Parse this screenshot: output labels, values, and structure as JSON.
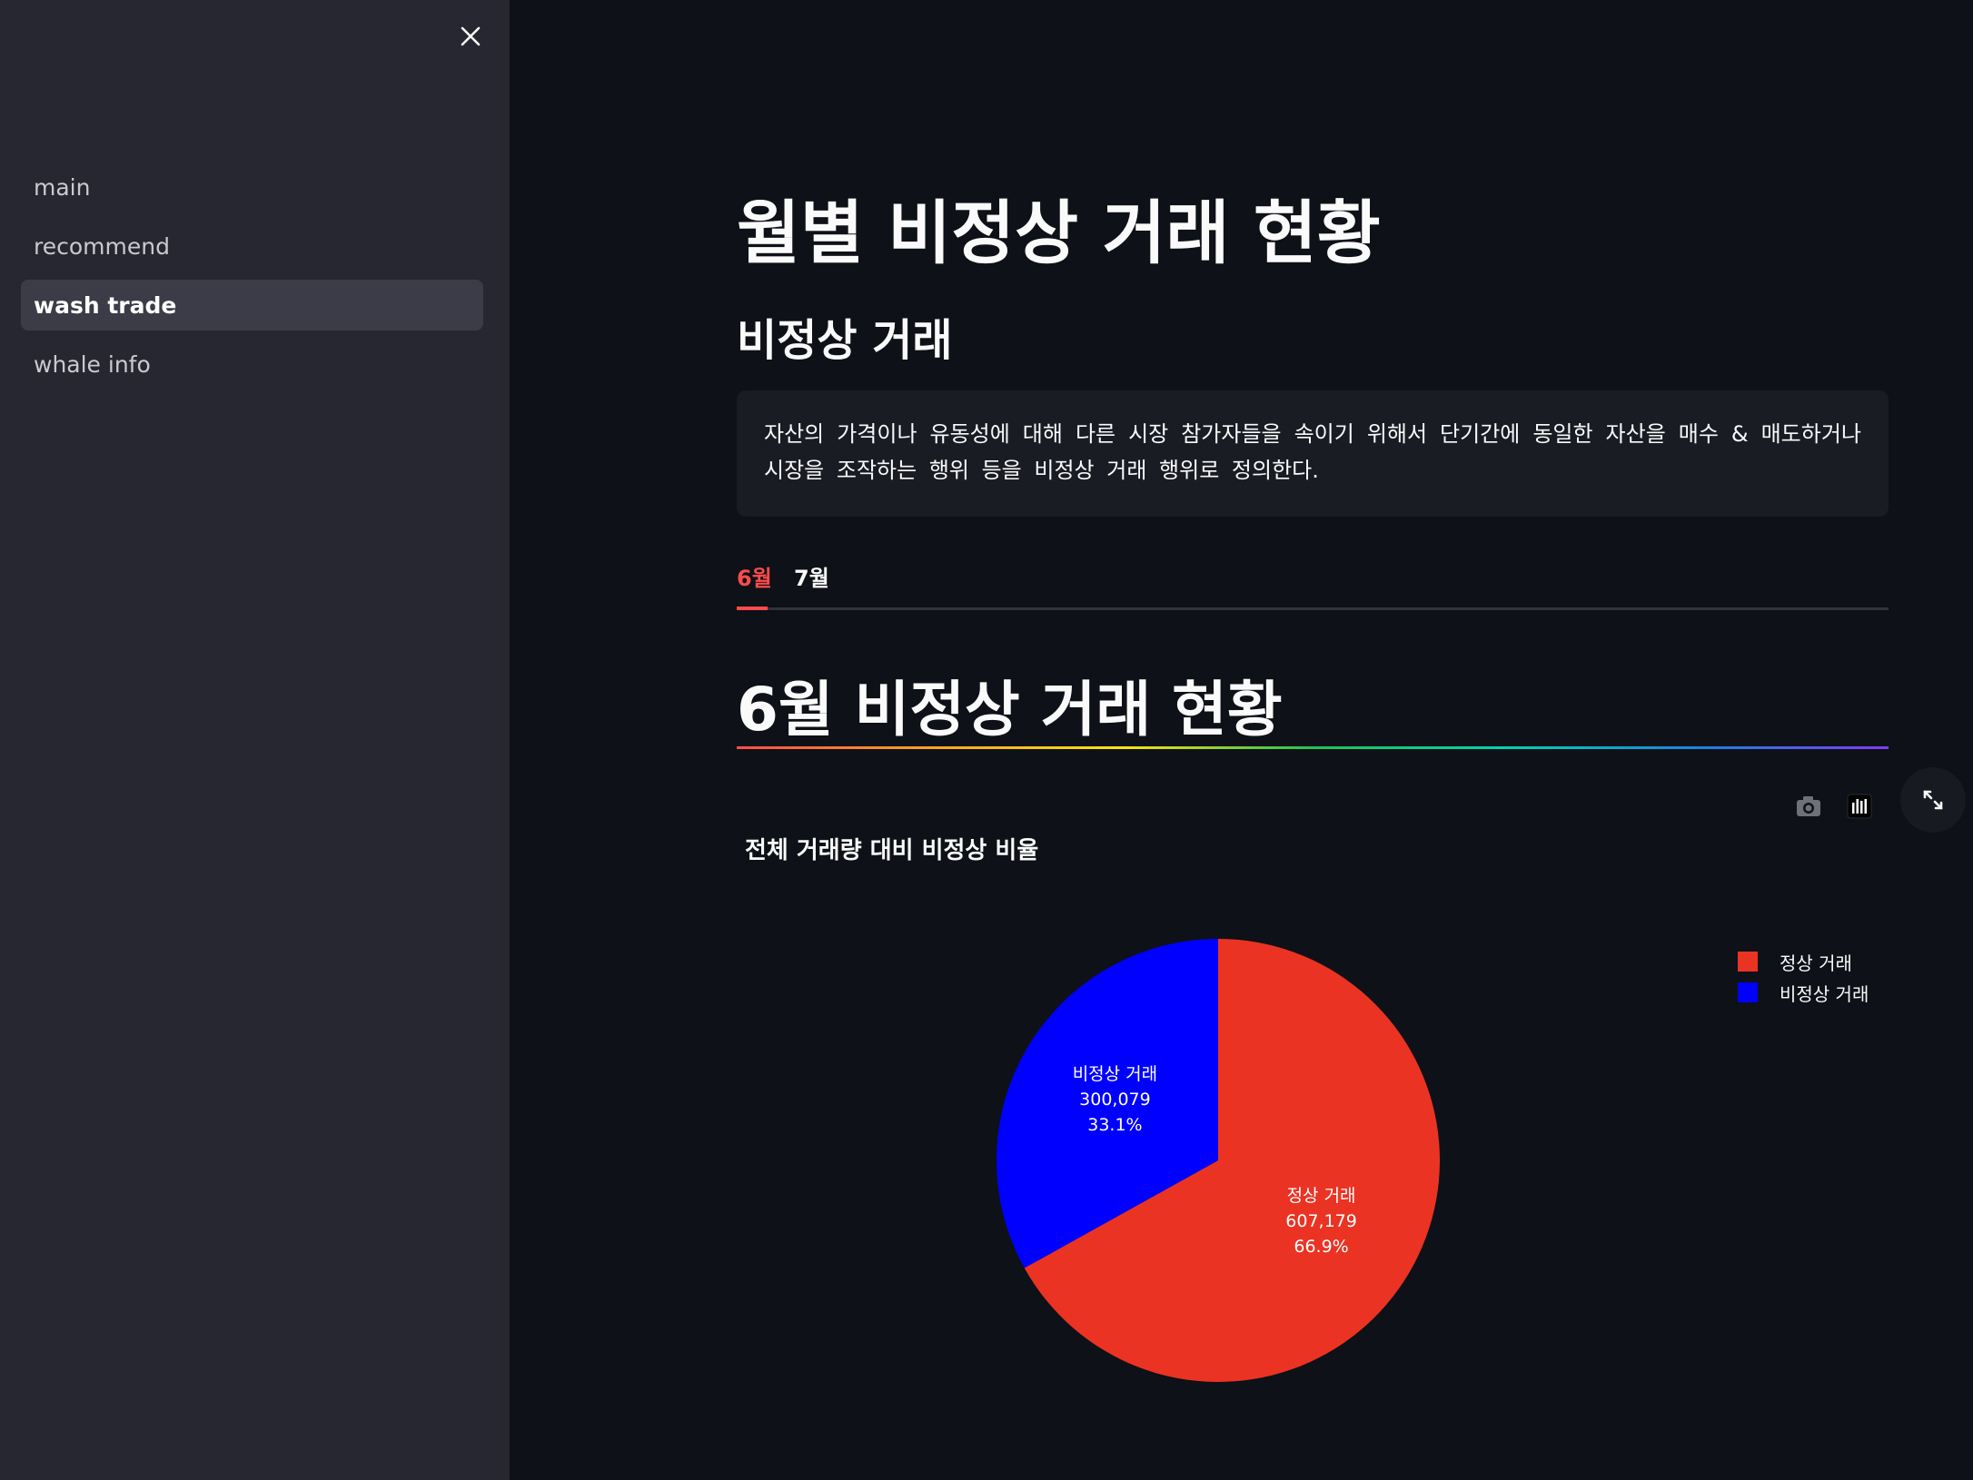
{
  "sidebar": {
    "items": [
      {
        "label": "main"
      },
      {
        "label": "recommend"
      },
      {
        "label": "wash trade"
      },
      {
        "label": "whale info"
      }
    ],
    "active_index": 2
  },
  "header": {
    "title": "월별 비정상 거래 현황"
  },
  "section": {
    "title": "비정상 거래",
    "definition": "자산의 가격이나 유동성에 대해 다른 시장 참가자들을 속이기 위해서 단기간에 동일한 자산을 매수 & 매도하거나 시장을 조작하는 행위 등을 비정상 거래 행위로 정의한다."
  },
  "tabs": [
    {
      "label": "6월",
      "active": true
    },
    {
      "label": "7월",
      "active": false
    }
  ],
  "month_section": {
    "title": "6월 비정상 거래 현황"
  },
  "colors": {
    "accent": "#ff4b4b",
    "normal_slice": "#eb3323",
    "abnormal_slice": "#0000ff",
    "background": "#0e1117",
    "sidebar": "#262730"
  },
  "icons": {
    "close": "close-icon",
    "camera": "camera-icon",
    "plotly_logo": "plotly-logo-icon",
    "fullscreen": "fullscreen-icon"
  },
  "chart_data": {
    "type": "pie",
    "title": "전체 거래량 대비 비정상 비율",
    "legend_placement": "top-right",
    "labels": [
      "정상 거래",
      "비정상 거래"
    ],
    "values": [
      607179,
      300079
    ],
    "display_values": [
      "607,179",
      "300,079"
    ],
    "percents": [
      "66.9%",
      "33.1%"
    ],
    "colors": [
      "#eb3323",
      "#0000ff"
    ]
  }
}
